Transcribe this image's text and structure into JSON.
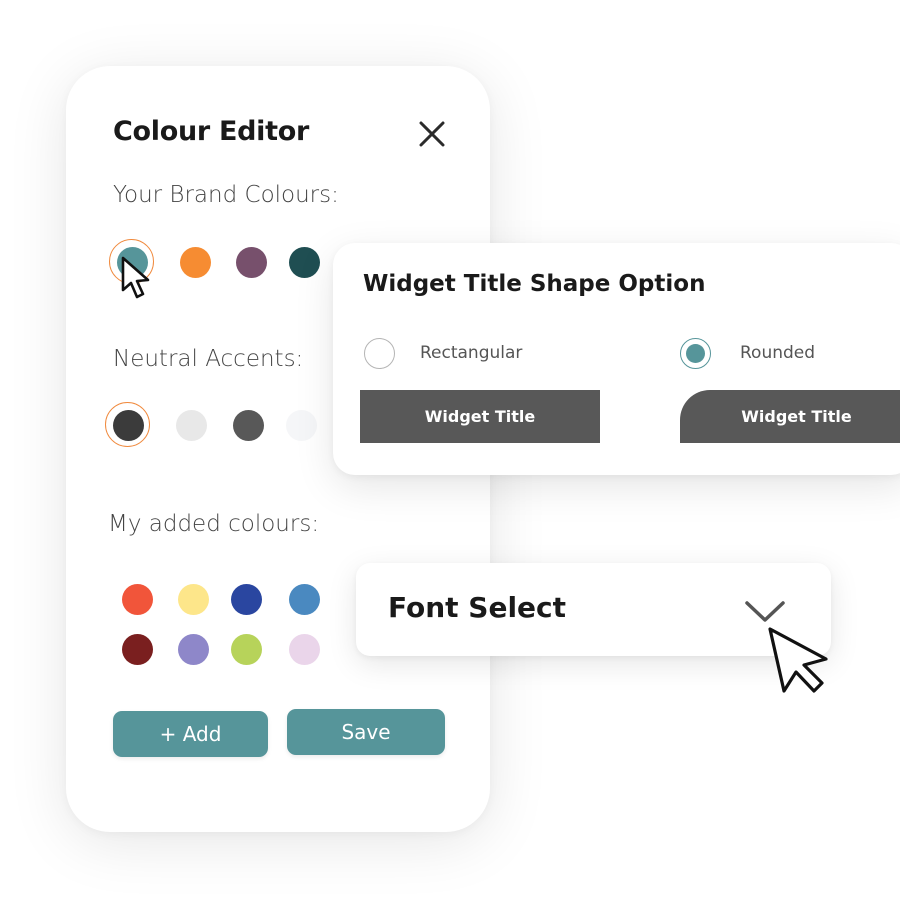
{
  "editor": {
    "title": "Colour Editor",
    "brand_label": "Your Brand Colours:",
    "brand_colors": [
      "#56959a",
      "#f68c32",
      "#77506c",
      "#1f4e52"
    ],
    "neutral_label": "Neutral Accents:",
    "neutral_colors": [
      "#3b3b3b",
      "#e8e8e8",
      "#585858",
      "#f5f6f8"
    ],
    "added_label": "My added colours:",
    "added_colors_row1": [
      "#f1553a",
      "#fde68a",
      "#2a46a0",
      "#4a89c0"
    ],
    "added_colors_row2": [
      "#7a1f1f",
      "#8e87c9",
      "#b7d35a",
      "#ead5ea"
    ],
    "add_label": "+ Add",
    "save_label": "Save"
  },
  "shape_option": {
    "title": "Widget Title Shape Option",
    "options": [
      {
        "label": "Rectangular",
        "selected": false,
        "preview": "Widget Title"
      },
      {
        "label": "Rounded",
        "selected": true,
        "preview": "Widget Title"
      }
    ]
  },
  "font_select": {
    "label": "Font Select"
  },
  "colors": {
    "accent": "#56959a",
    "selection_ring": "#f08a3e",
    "preview_fill": "#585858"
  },
  "icons": [
    "close-icon",
    "pointer-cursor-icon",
    "chevron-down-icon"
  ]
}
